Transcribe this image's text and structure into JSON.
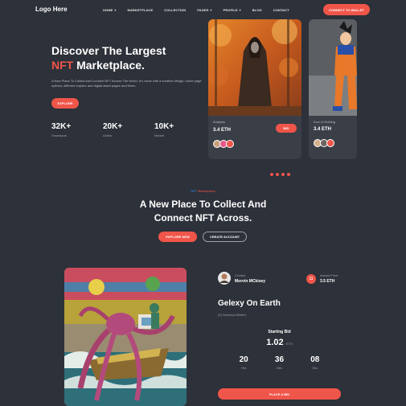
{
  "header": {
    "logo": "Logo Here",
    "nav": [
      {
        "label": "HOME",
        "caret": true
      },
      {
        "label": "MARKETPLACE",
        "caret": false
      },
      {
        "label": "COLLECTION",
        "caret": false
      },
      {
        "label": "PAGES",
        "caret": true
      },
      {
        "label": "PROFILE",
        "caret": true
      },
      {
        "label": "BLOG",
        "caret": false
      },
      {
        "label": "CONTACT",
        "caret": false
      }
    ],
    "connect_label": "CONNECT TO WALLET"
  },
  "hero": {
    "title_line1": "Discover The Largest",
    "title_accent": "NFT",
    "title_line2_rest": " Marketplace.",
    "description": "A New Place To Collect And Connect NFT Across The World. It's come with a creative design, home page options, different explore and digital asset pages and items.",
    "explore_label": "EXPLORE",
    "stats": [
      {
        "value": "32K+",
        "label": "Smartwork"
      },
      {
        "value": "20K+",
        "label": "Action"
      },
      {
        "value": "10K+",
        "label": "Market"
      }
    ]
  },
  "cards": [
    {
      "label": "Analysis",
      "price": "3.4 ETH",
      "bid_label": "BID"
    },
    {
      "label": "Kuro & Nothing",
      "price": "3.4 ETH"
    }
  ],
  "section": {
    "tag_blue": "NFT",
    "tag_red": " Marketplace",
    "title_line1": "A New Place To Collect And",
    "title_line2": "Connect NFT Across.",
    "explore_new_label": "EXPLORE NEW",
    "create_account_label": "CREATE ACCOUNT"
  },
  "featured": {
    "creator_label": "Creator",
    "creator_name": "Morvin MCkisey",
    "price_label": "Instant Price",
    "price_value": "3.5 ETH",
    "title": "Gelexy On Earth",
    "minted": "(3) Schezrpl Minted",
    "starting_bid_label": "Starting Bid",
    "starting_bid_value": "1.02",
    "starting_bid_unit": "ETH",
    "timer": [
      {
        "value": "20",
        "label": "Hrs"
      },
      {
        "value": "36",
        "label": "Min"
      },
      {
        "value": "08",
        "label": "Sec"
      }
    ],
    "place_bid_label": "PLACE A BID"
  },
  "colors": {
    "accent": "#f0554a",
    "background": "#2d3139",
    "card": "#3a3e47",
    "blue": "#3a8df0"
  }
}
